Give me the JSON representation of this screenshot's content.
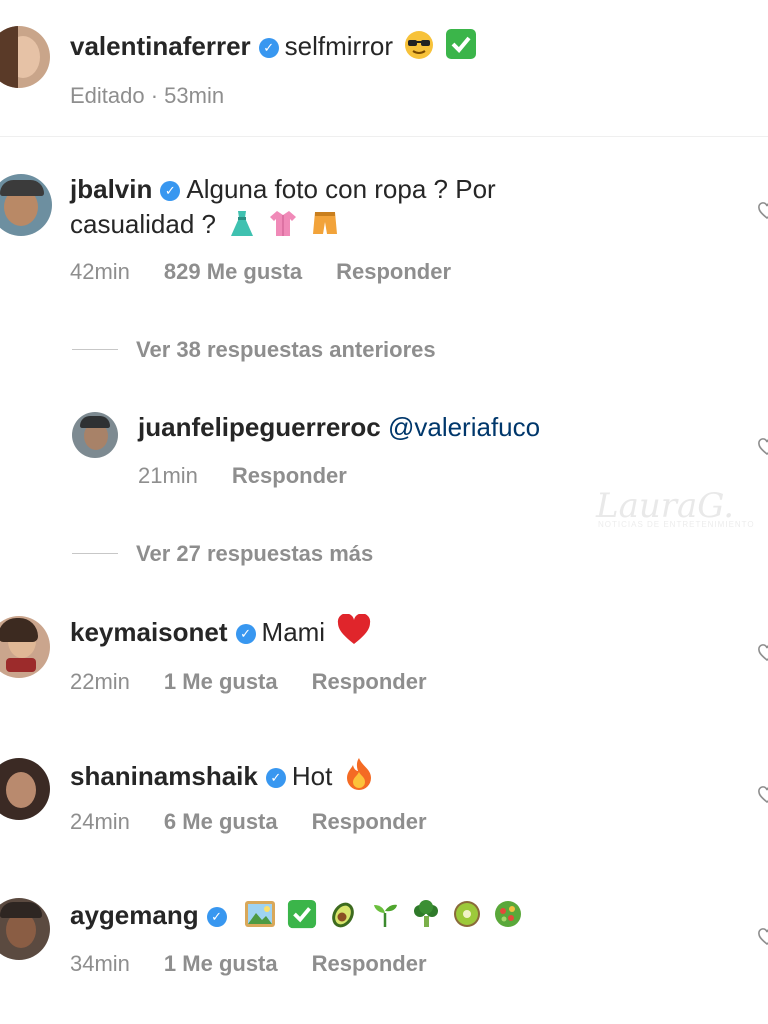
{
  "caption": {
    "username": "valentinaferrer",
    "text": "selfmirror",
    "meta": "Editado · 53min"
  },
  "comments": [
    {
      "username": "jbalvin",
      "text_line1": "Alguna foto con ropa ? Por",
      "text_line2": "casualidad ?",
      "time": "42min",
      "likes": "829 Me gusta",
      "reply": "Responder"
    },
    {
      "username": "keymaisonet",
      "text": "Mami",
      "time": "22min",
      "likes": "1 Me gusta",
      "reply": "Responder"
    },
    {
      "username": "shaninamshaik",
      "text": "Hot",
      "time": "24min",
      "likes": "6 Me gusta",
      "reply": "Responder"
    },
    {
      "username": "aygemang",
      "time": "34min",
      "likes": "1 Me gusta",
      "reply": "Responder"
    }
  ],
  "replies": {
    "view_previous": "Ver 38 respuestas anteriores",
    "view_more": "Ver 27 respuestas más",
    "reply": {
      "username": "juanfelipeguerreroc",
      "mention": "@valeriafuco",
      "time": "21min",
      "reply": "Responder"
    }
  },
  "watermark": {
    "brand": "LauraG.",
    "tagline": "NOTICIAS DE ENTRETENIMIENTO"
  },
  "icons": {
    "verified": "verified-badge-icon",
    "like": "heart-outline-icon"
  },
  "colors": {
    "verified": "#3897f0",
    "mention": "#00376b",
    "muted": "#8e8e8e"
  }
}
